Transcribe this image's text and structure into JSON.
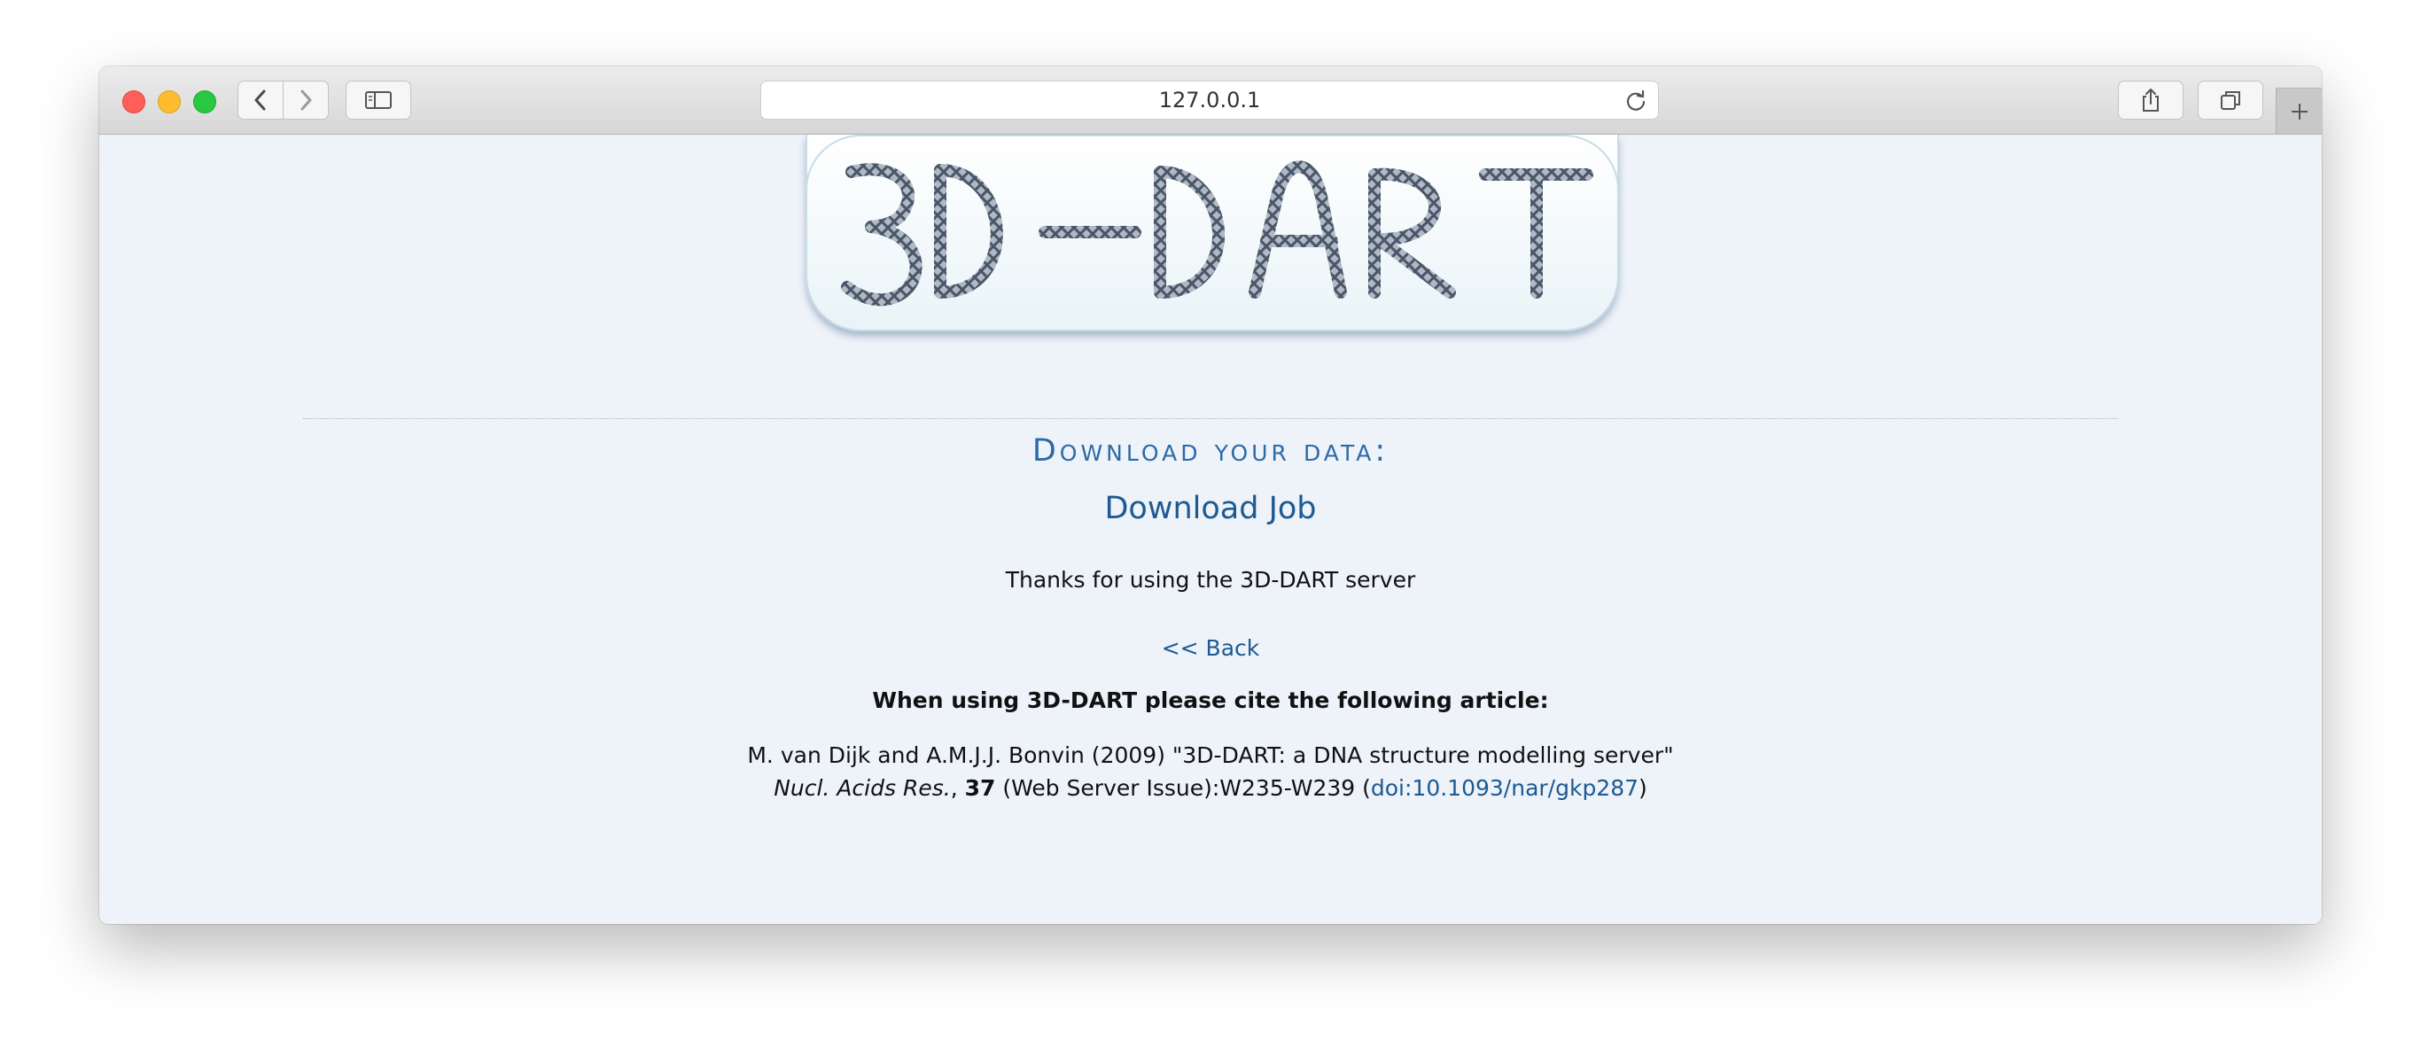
{
  "browser": {
    "url": "127.0.0.1"
  },
  "logo": {
    "text": "3D-DART"
  },
  "main": {
    "heading": "Download your data:",
    "download_link": "Download Job",
    "thanks": "Thanks for using the 3D-DART server",
    "back_link": "<< Back",
    "cite_heading": "When using 3D-DART please cite the following article:",
    "citation": {
      "line1": "M. van Dijk and A.M.J.J. Bonvin (2009) \"3D-DART: a DNA structure modelling server\"",
      "journal": "Nucl. Acids Res.",
      "sep": ", ",
      "volume": "37",
      "issue": " (Web Server Issue):W235-W239 (",
      "doi": "doi:10.1093/nar/gkp287",
      "close": ")"
    }
  },
  "colors": {
    "link": "#1d5a92",
    "heading": "#2d6aa8",
    "page_bg": "#eef2f9"
  }
}
